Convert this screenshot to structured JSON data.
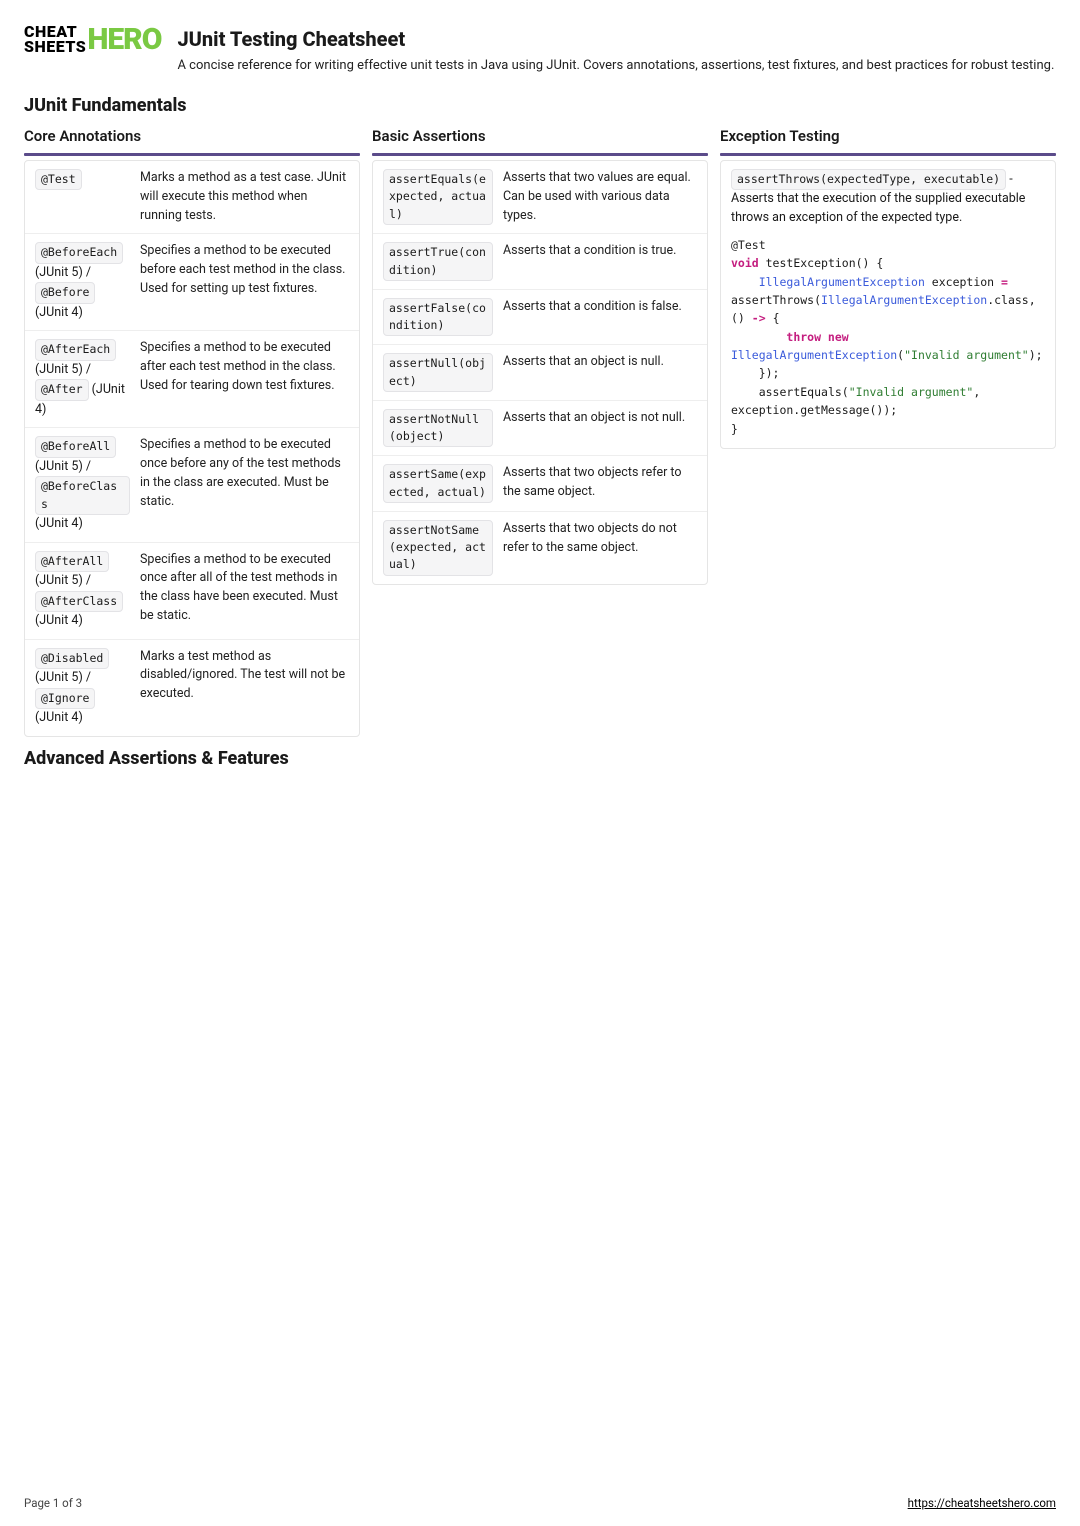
{
  "header": {
    "logo_top": "CHEAT",
    "logo_bottom": "SHEETS",
    "logo_right": "HERO",
    "title": "JUnit Testing Cheatsheet",
    "subtitle": "A concise reference for writing effective unit tests in Java using JUnit. Covers annotations, assertions, test fixtures, and best practices for robust testing."
  },
  "section1_title": "JUnit Fundamentals",
  "core": {
    "heading": "Core Annotations",
    "rows": [
      {
        "code1": "@Test",
        "after1": "",
        "code2": "",
        "after2": "",
        "desc": "Marks a method as a test case. JUnit will execute this method when running tests."
      },
      {
        "code1": "@BeforeEach",
        "after1": " (JUnit 5) / ",
        "code2": "@Before",
        "after2": " (JUnit 4)",
        "desc": "Specifies a method to be executed before each test method in the class. Used for setting up test fixtures."
      },
      {
        "code1": "@AfterEach",
        "after1": " (JUnit 5) / ",
        "code2": "@After",
        "after2": " (JUnit 4)",
        "desc": "Specifies a method to be executed after each test method in the class. Used for tearing down test fixtures."
      },
      {
        "code1": "@BeforeAll",
        "after1": " (JUnit 5) / ",
        "code2": "@BeforeClass",
        "after2": " (JUnit 4)",
        "desc": "Specifies a method to be executed once before any of the test methods in the class are executed. Must be static."
      },
      {
        "code1": "@AfterAll",
        "after1": " (JUnit 5) / ",
        "code2": "@AfterClass",
        "after2": " (JUnit 4)",
        "desc": "Specifies a method to be executed once after all of the test methods in the class have been executed. Must be static."
      },
      {
        "code1": "@Disabled",
        "after1": " (JUnit 5) / ",
        "code2": "@Ignore",
        "after2": " (JUnit 4)",
        "desc": "Marks a test method as disabled/ignored. The test will not be executed."
      }
    ]
  },
  "asserts": {
    "heading": "Basic Assertions",
    "rows": [
      {
        "code": "assertEquals(expected, actual)",
        "desc": "Asserts that two values are equal. Can be used with various data types."
      },
      {
        "code": "assertTrue(condition)",
        "desc": "Asserts that a condition is true."
      },
      {
        "code": "assertFalse(condition)",
        "desc": "Asserts that a condition is false."
      },
      {
        "code": "assertNull(object)",
        "desc": "Asserts that an object is null."
      },
      {
        "code": "assertNotNull(object)",
        "desc": "Asserts that an object is not null."
      },
      {
        "code": "assertSame(expected, actual)",
        "desc": "Asserts that two objects refer to the same object."
      },
      {
        "code": "assertNotSame(expected, actual)",
        "desc": "Asserts that two objects do not refer to the same object."
      }
    ]
  },
  "exc": {
    "heading": "Exception Testing",
    "intro_code": "assertThrows(expectedType, executable)",
    "intro_text": " - Asserts that the execution of the supplied executable throws an exception of the expected type.",
    "code": {
      "l1": "@Test",
      "l2a": "void",
      "l2b": " testException() {",
      "l3a": "    ",
      "l3b": "IllegalArgumentException",
      "l3c": " exception ",
      "l3d": "=",
      "l4a": "assertThrows(",
      "l4b": "IllegalArgumentException",
      "l4c": ".class, () ",
      "l4d": "->",
      "l4e": " {",
      "l5a": "        ",
      "l5b": "throw new",
      "l6a": "IllegalArgumentException",
      "l6b": "(",
      "l6c": "\"Invalid argument\"",
      "l6d": ");",
      "l7": "    });",
      "l8a": "    assertEquals(",
      "l8b": "\"Invalid argument\"",
      "l8c": ",",
      "l9": "exception.getMessage());",
      "l10": "}"
    }
  },
  "section2_title": "Advanced Assertions & Features",
  "footer": {
    "page": "Page 1 of 3",
    "url": "https://cheatsheetshero.com"
  }
}
